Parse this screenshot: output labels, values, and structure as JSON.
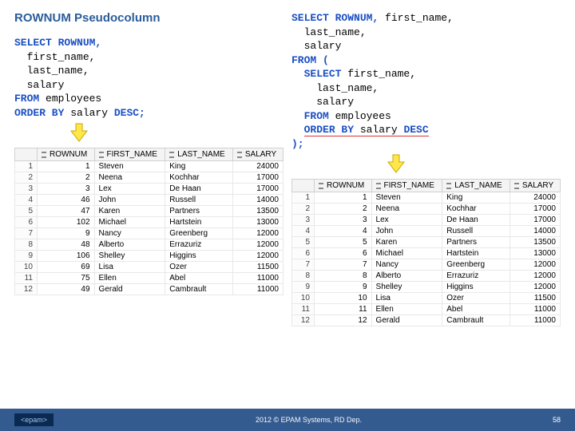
{
  "title": "ROWNUM Pseudocolumn",
  "left_code": {
    "l1a": "SELECT",
    "l1b": "ROWNUM,",
    "l2": "  first_name,",
    "l3": "  last_name,",
    "l4": "  salary",
    "l5a": "FROM",
    "l5b": " employees",
    "l6a": "ORDER BY",
    "l6b": " salary ",
    "l6c": "DESC;"
  },
  "right_code": {
    "l1a": "SELECT",
    "l1b": "ROWNUM,",
    "l1c": " first_name,",
    "l2": "  last_name,",
    "l3": "  salary",
    "l4a": "FROM",
    "l4b": " (",
    "l5a": "SELECT",
    "l5b": " first_name,",
    "l6": "    last_name,",
    "l7": "    salary",
    "l8a": "FROM",
    "l8b": " employees",
    "l9a": "ORDER BY",
    "l9b": " salary ",
    "l9c": "DESC",
    "l10": ");"
  },
  "headers": {
    "rownum": "ROWNUM",
    "first": "FIRST_NAME",
    "last": "LAST_NAME",
    "salary": "SALARY"
  },
  "left_rows": [
    {
      "i": 1,
      "r": 1,
      "f": "Steven",
      "l": "King",
      "s": 24000
    },
    {
      "i": 2,
      "r": 2,
      "f": "Neena",
      "l": "Kochhar",
      "s": 17000
    },
    {
      "i": 3,
      "r": 3,
      "f": "Lex",
      "l": "De Haan",
      "s": 17000
    },
    {
      "i": 4,
      "r": 46,
      "f": "John",
      "l": "Russell",
      "s": 14000
    },
    {
      "i": 5,
      "r": 47,
      "f": "Karen",
      "l": "Partners",
      "s": 13500
    },
    {
      "i": 6,
      "r": 102,
      "f": "Michael",
      "l": "Hartstein",
      "s": 13000
    },
    {
      "i": 7,
      "r": 9,
      "f": "Nancy",
      "l": "Greenberg",
      "s": 12000
    },
    {
      "i": 8,
      "r": 48,
      "f": "Alberto",
      "l": "Errazuriz",
      "s": 12000
    },
    {
      "i": 9,
      "r": 106,
      "f": "Shelley",
      "l": "Higgins",
      "s": 12000
    },
    {
      "i": 10,
      "r": 69,
      "f": "Lisa",
      "l": "Ozer",
      "s": 11500
    },
    {
      "i": 11,
      "r": 75,
      "f": "Ellen",
      "l": "Abel",
      "s": 11000
    },
    {
      "i": 12,
      "r": 49,
      "f": "Gerald",
      "l": "Cambrault",
      "s": 11000
    }
  ],
  "right_rows": [
    {
      "i": 1,
      "r": 1,
      "f": "Steven",
      "l": "King",
      "s": 24000
    },
    {
      "i": 2,
      "r": 2,
      "f": "Neena",
      "l": "Kochhar",
      "s": 17000
    },
    {
      "i": 3,
      "r": 3,
      "f": "Lex",
      "l": "De Haan",
      "s": 17000
    },
    {
      "i": 4,
      "r": 4,
      "f": "John",
      "l": "Russell",
      "s": 14000
    },
    {
      "i": 5,
      "r": 5,
      "f": "Karen",
      "l": "Partners",
      "s": 13500
    },
    {
      "i": 6,
      "r": 6,
      "f": "Michael",
      "l": "Hartstein",
      "s": 13000
    },
    {
      "i": 7,
      "r": 7,
      "f": "Nancy",
      "l": "Greenberg",
      "s": 12000
    },
    {
      "i": 8,
      "r": 8,
      "f": "Alberto",
      "l": "Errazuriz",
      "s": 12000
    },
    {
      "i": 9,
      "r": 9,
      "f": "Shelley",
      "l": "Higgins",
      "s": 12000
    },
    {
      "i": 10,
      "r": 10,
      "f": "Lisa",
      "l": "Ozer",
      "s": 11500
    },
    {
      "i": 11,
      "r": 11,
      "f": "Ellen",
      "l": "Abel",
      "s": 11000
    },
    {
      "i": 12,
      "r": 12,
      "f": "Gerald",
      "l": "Cambrault",
      "s": 11000
    }
  ],
  "footer": {
    "logo": "<epam>",
    "copy": "2012 © EPAM Systems, RD Dep.",
    "page": "58"
  }
}
